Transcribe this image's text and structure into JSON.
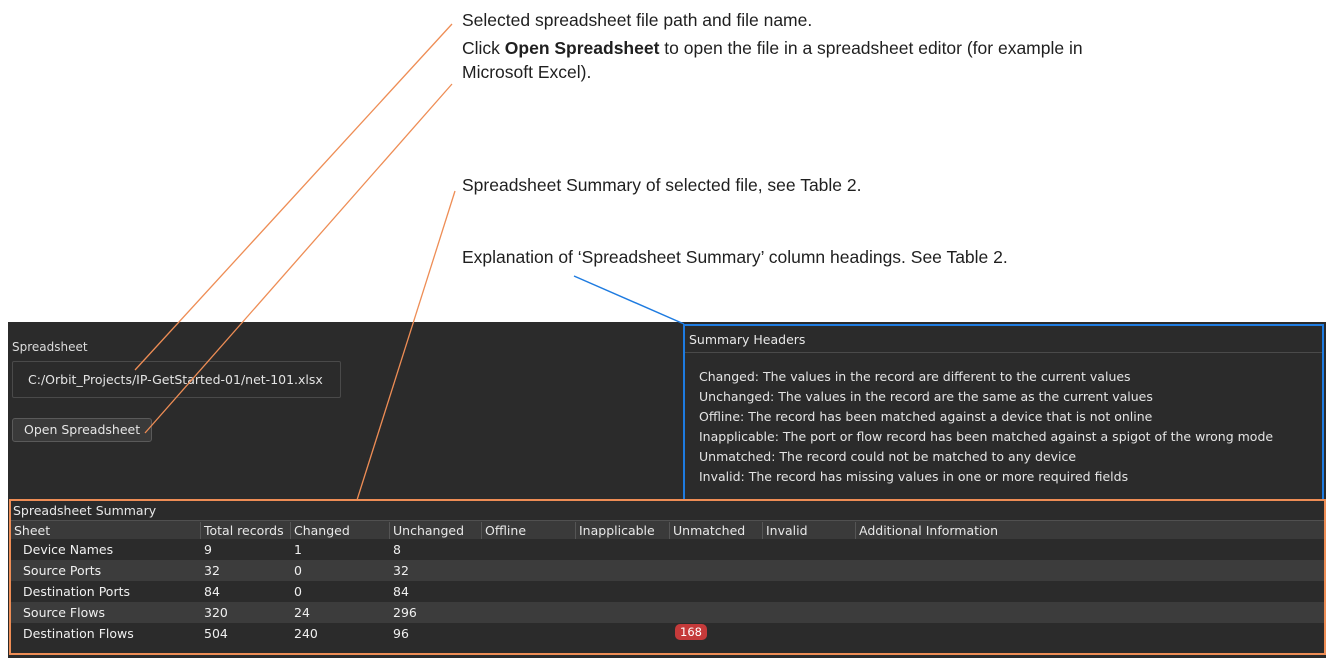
{
  "annotations": {
    "path_note": "Selected spreadsheet file path and file name.",
    "open_note_prefix": "Click ",
    "open_note_bold": "Open Spreadsheet",
    "open_note_suffix": " to open the file in a spreadsheet editor (for example in Microsoft Excel).",
    "summary_note": "Spreadsheet Summary of selected file, see Table 2.",
    "headers_note": "Explanation of ‘Spreadsheet Summary’ column headings. See Table 2."
  },
  "spreadsheet": {
    "label": "Spreadsheet",
    "path": "C:/Orbit_Projects/IP-GetStarted-01/net-101.xlsx",
    "open_button": "Open Spreadsheet"
  },
  "summary_headers": {
    "title": "Summary Headers",
    "lines": [
      "Changed: The values in the record are different to the current values",
      "Unchanged: The values in the record are the same as the current values",
      "Offline: The record has been matched against a device that is not online",
      "Inapplicable: The port or flow record has been matched against a spigot of the wrong mode",
      "Unmatched: The record could not be matched to any device",
      "Invalid: The record has missing values in one or more required fields"
    ]
  },
  "summary_table": {
    "title": "Spreadsheet Summary",
    "columns": [
      "Sheet",
      "Total records",
      "Changed",
      "Unchanged",
      "Offline",
      "Inapplicable",
      "Unmatched",
      "Invalid",
      "Additional Information"
    ],
    "rows": [
      {
        "sheet": "Device Names",
        "total": "9",
        "changed": "1",
        "unchanged": "8",
        "unmatched": ""
      },
      {
        "sheet": "Source Ports",
        "total": "32",
        "changed": "0",
        "unchanged": "32",
        "unmatched": ""
      },
      {
        "sheet": "Destination Ports",
        "total": "84",
        "changed": "0",
        "unchanged": "84",
        "unmatched": ""
      },
      {
        "sheet": "Source Flows",
        "total": "320",
        "changed": "24",
        "unchanged": "296",
        "unmatched": ""
      },
      {
        "sheet": "Destination Flows",
        "total": "504",
        "changed": "240",
        "unchanged": "96",
        "unmatched": "168"
      }
    ]
  },
  "colors": {
    "callout_orange": "#ee8d55",
    "callout_blue": "#1e7be0",
    "panel_bg": "#2b2b2b",
    "badge_red": "#c53a3a"
  }
}
